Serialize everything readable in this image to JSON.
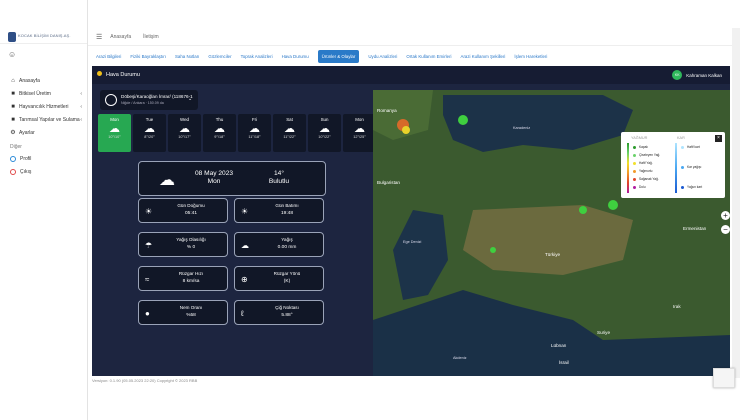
{
  "brand": {
    "title": "KOCAK BİLİŞİM DANIŞ.AŞ."
  },
  "sidebar": {
    "items": [
      {
        "label": "Anasayfa",
        "icon": "home-icon",
        "chevron": false
      },
      {
        "label": "Bitkisel Üretim",
        "icon": "folder-icon",
        "chevron": true
      },
      {
        "label": "Hayvancılık Hizmetleri",
        "icon": "folder-icon",
        "chevron": true
      },
      {
        "label": "Tarımsal Yapılar ve Sulama",
        "icon": "folder-icon",
        "chevron": true
      },
      {
        "label": "Ayarlar",
        "icon": "gear-icon",
        "chevron": false
      }
    ],
    "section": "Diğer",
    "others": [
      {
        "label": "Profil"
      },
      {
        "label": "Çıkış"
      }
    ]
  },
  "topbar": {
    "links": [
      "Anasayfa",
      "İletişim"
    ]
  },
  "tabs": [
    {
      "label": "Arazi Bilgileri",
      "active": false
    },
    {
      "label": "Fiziki Bayraklaştırı",
      "active": false
    },
    {
      "label": "Saha Notları",
      "active": false
    },
    {
      "label": "Gözlemciler",
      "active": false
    },
    {
      "label": "Toprak Analizleri",
      "active": false
    },
    {
      "label": "Hava Durumu",
      "active": false
    },
    {
      "label": "Ürünler & Olaylar",
      "active": true
    },
    {
      "label": "Uydu Analizleri",
      "active": false
    },
    {
      "label": "Ortak Kullanım Emirleri",
      "active": false
    },
    {
      "label": "Arazi Kullanım Şekilleri",
      "active": false
    },
    {
      "label": "İşlem Hareketleri",
      "active": false
    }
  ],
  "panel": {
    "title": "Hava Durumu",
    "user_initials": "KK",
    "user_name": "Kahraman Kalkan"
  },
  "location": {
    "title": "Döbeşi/Karaoğlan İmrar/ (118676-1",
    "subtitle": "Niğde / Ankara · 150.09 da"
  },
  "forecast": [
    {
      "day": "Mon",
      "temp": "10°/10°",
      "active": true
    },
    {
      "day": "Tue",
      "temp": "8°/20°",
      "active": false
    },
    {
      "day": "Wed",
      "temp": "10°/17°",
      "active": false
    },
    {
      "day": "Thu",
      "temp": "9°/18°",
      "active": false
    },
    {
      "day": "Fri",
      "temp": "11°/18°",
      "active": false
    },
    {
      "day": "Sat",
      "temp": "11°/22°",
      "active": false
    },
    {
      "day": "Sun",
      "temp": "10°/22°",
      "active": false
    },
    {
      "day": "Mon",
      "temp": "12°/25°",
      "active": false
    }
  ],
  "current": {
    "date": "08 May 2023",
    "weekday": "Mon",
    "temp": "14°",
    "condition": "Bulutlu"
  },
  "stats": [
    {
      "label": "Gün Doğumu",
      "value": "05:41",
      "icon": "sunrise-icon"
    },
    {
      "label": "Gün Batımı",
      "value": "19:48",
      "icon": "sunset-icon"
    },
    {
      "label": "Yağış Olasılığı",
      "value": "% 0",
      "icon": "umbrella-icon"
    },
    {
      "label": "Yağış",
      "value": "0.00 mm",
      "icon": "rain-cloud-icon"
    },
    {
      "label": "Rüzgar Hızı",
      "value": "8 km/sa",
      "icon": "wind-icon"
    },
    {
      "label": "Rüzgar Yönü",
      "value": "(K)",
      "icon": "compass-icon"
    },
    {
      "label": "Nem Oranı",
      "value": "%58",
      "icon": "humidity-icon"
    },
    {
      "label": "Çiğ Noktası",
      "value": "5.88°",
      "icon": "thermometer-icon"
    }
  ],
  "map": {
    "labels": [
      "Romanya",
      "Bulgaristan",
      "Türkiye",
      "Ermenistan",
      "Suriye",
      "Irak",
      "Lübnan",
      "İsrail"
    ],
    "water": [
      "Karadeniz",
      "Akdeniz",
      "Ege Denizi"
    ],
    "legend": {
      "rain_title": "YAĞMUR",
      "snow_title": "KAR",
      "rain": [
        {
          "label": "Kapalı",
          "color": "#2a9a2a"
        },
        {
          "label": "Çiseleyen Yağ.",
          "color": "#6ad26a"
        },
        {
          "label": "Hafif Yağ.",
          "color": "#f2e02a"
        },
        {
          "label": "Yağmurlu",
          "color": "#f29a2a"
        },
        {
          "label": "Sağanak Yağ.",
          "color": "#e0442a"
        },
        {
          "label": "Dolu",
          "color": "#b01aa0"
        }
      ],
      "snow": [
        {
          "label": "Hafif kart",
          "color": "#aee4ff"
        },
        {
          "label": "Kar yağışı",
          "color": "#4aa8f2"
        },
        {
          "label": "Yoğun kart",
          "color": "#1a5ad2"
        }
      ],
      "close": "×"
    },
    "zoom_in": "+",
    "zoom_out": "−"
  },
  "footer": "Versiyon: 0.1.90 (05.05.2023 22:20) Copyright © 2023 RBB"
}
